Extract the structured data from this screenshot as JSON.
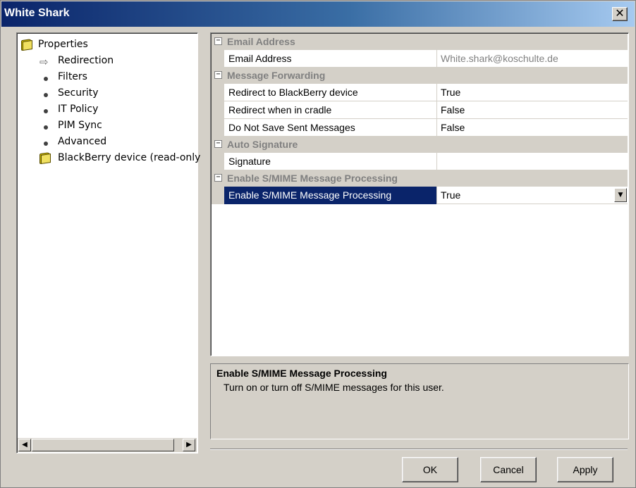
{
  "window": {
    "title": "White Shark",
    "close_glyph": "✕"
  },
  "tree": {
    "items": [
      {
        "label": "Properties",
        "icon": "folder-icon"
      },
      {
        "label": "Redirection",
        "icon": "arrow-right-icon"
      },
      {
        "label": "Filters",
        "icon": "bullet-icon"
      },
      {
        "label": "Security",
        "icon": "bullet-icon"
      },
      {
        "label": "IT Policy",
        "icon": "bullet-icon"
      },
      {
        "label": "PIM Sync",
        "icon": "bullet-icon"
      },
      {
        "label": "Advanced",
        "icon": "bullet-icon"
      },
      {
        "label": "BlackBerry device (read-only",
        "icon": "folder-icon"
      }
    ],
    "arrow_glyph": "⇨",
    "scroll_left": "◀",
    "scroll_right": "▶"
  },
  "grid": {
    "collapse_glyph": "−",
    "categories": [
      {
        "label": "Email Address"
      },
      {
        "label": "Message Forwarding"
      },
      {
        "label": "Auto Signature"
      },
      {
        "label": "Enable S/MIME Message Processing"
      }
    ],
    "rows": [
      {
        "name": "Email Address",
        "value": "White.shark@koschulte.de"
      },
      {
        "name": "Redirect to BlackBerry device",
        "value": "True"
      },
      {
        "name": "Redirect when in cradle",
        "value": "False"
      },
      {
        "name": "Do Not Save Sent Messages",
        "value": "False"
      },
      {
        "name": "Signature",
        "value": ""
      },
      {
        "name": "Enable S/MIME Message Processing",
        "value": "True"
      }
    ],
    "dropdown_glyph": "▼"
  },
  "description": {
    "title": "Enable S/MIME Message Processing",
    "text": "Turn on or turn off S/MIME messages for this user."
  },
  "buttons": {
    "ok": "OK",
    "cancel": "Cancel",
    "apply": "Apply"
  },
  "colors": {
    "selection": "#0a246a",
    "titlebar": "#0a246a",
    "face": "#d4d0c8"
  }
}
